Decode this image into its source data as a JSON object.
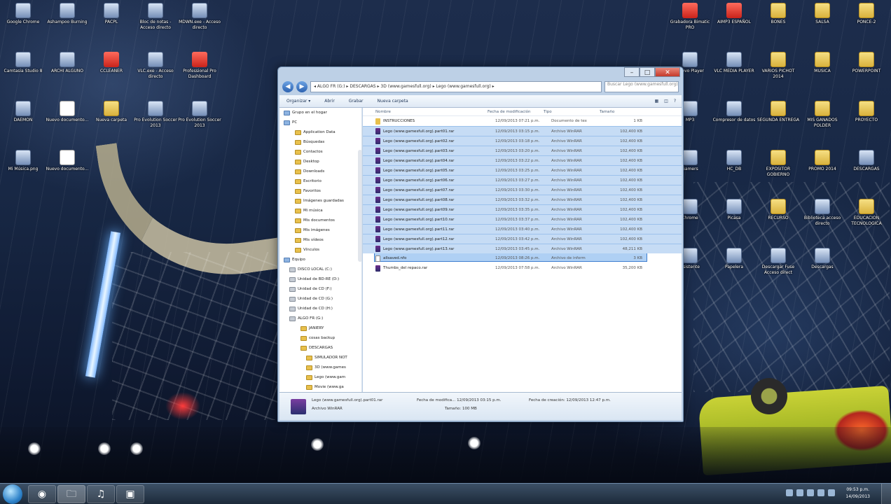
{
  "explorer": {
    "address": "◂ ALGO FR (G:) ▸ DESCARGAS ▸ 3D (www.gamesfull.org) ▸ Lego (www.gamesfull.org) ▸",
    "search_placeholder": "Buscar Lego (www.gamesfull.org)",
    "toolbar": {
      "organize": "Organizar ▾",
      "open": "Abrir",
      "share": "Grabar",
      "new_folder": "Nueva carpeta"
    },
    "columns": {
      "name": "Nombre",
      "date": "Fecha de modificación",
      "type": "Tipo",
      "size": "Tamaño"
    },
    "nav": [
      {
        "label": "Grupo en el hogar",
        "kind": "pc"
      },
      {
        "label": "PC",
        "kind": "pc"
      },
      {
        "label": "Application Data",
        "kind": "folder"
      },
      {
        "label": "Búsquedas",
        "kind": "folder"
      },
      {
        "label": "Contactos",
        "kind": "folder"
      },
      {
        "label": "Desktop",
        "kind": "folder"
      },
      {
        "label": "Downloads",
        "kind": "folder"
      },
      {
        "label": "Escritorio",
        "kind": "folder"
      },
      {
        "label": "Favoritos",
        "kind": "folder"
      },
      {
        "label": "Imágenes guardadas",
        "kind": "folder"
      },
      {
        "label": "Mi música",
        "kind": "folder"
      },
      {
        "label": "Mis documentos",
        "kind": "folder"
      },
      {
        "label": "Mis imágenes",
        "kind": "folder"
      },
      {
        "label": "Mis vídeos",
        "kind": "folder"
      },
      {
        "label": "Vínculos",
        "kind": "folder"
      },
      {
        "label": "Equipo",
        "kind": "pc"
      },
      {
        "label": "DISCO LOCAL (C:)",
        "kind": "drive"
      },
      {
        "label": "Unidad de BD-RE (D:)",
        "kind": "drive"
      },
      {
        "label": "Unidad de CD (F:)",
        "kind": "drive"
      },
      {
        "label": "Unidad de CD (G:)",
        "kind": "drive"
      },
      {
        "label": "Unidad de CD (H:)",
        "kind": "drive"
      },
      {
        "label": "ALGO FR (G:)",
        "kind": "drive"
      },
      {
        "label": "JANIERY",
        "kind": "folder"
      },
      {
        "label": "cosas backup",
        "kind": "folder"
      },
      {
        "label": "DESCARGAS",
        "kind": "folder"
      },
      {
        "label": "SIMULADOR NOT",
        "kind": "folder"
      },
      {
        "label": "3D (www.games",
        "kind": "folder"
      },
      {
        "label": "Lego (www.gam",
        "kind": "folder"
      },
      {
        "label": "Movie (www.ga",
        "kind": "folder"
      }
    ],
    "files": [
      {
        "name": "INSTRUCCIONES",
        "date": "12/09/2013 07:21 p.m.",
        "type": "Documento de tex",
        "size": "1 KB",
        "icon": "folder",
        "sel": false
      },
      {
        "name": "Lego (www.gamesfull.org).part01.rar",
        "date": "12/09/2013 03:15 p.m.",
        "type": "Archivo WinRAR",
        "size": "102,400 KB",
        "icon": "rar",
        "sel": true
      },
      {
        "name": "Lego (www.gamesfull.org).part02.rar",
        "date": "12/09/2013 03:18 p.m.",
        "type": "Archivo WinRAR",
        "size": "102,400 KB",
        "icon": "rar",
        "sel": true
      },
      {
        "name": "Lego (www.gamesfull.org).part03.rar",
        "date": "12/09/2013 03:20 p.m.",
        "type": "Archivo WinRAR",
        "size": "102,400 KB",
        "icon": "rar",
        "sel": true
      },
      {
        "name": "Lego (www.gamesfull.org).part04.rar",
        "date": "12/09/2013 03:22 p.m.",
        "type": "Archivo WinRAR",
        "size": "102,400 KB",
        "icon": "rar",
        "sel": true
      },
      {
        "name": "Lego (www.gamesfull.org).part05.rar",
        "date": "12/09/2013 03:25 p.m.",
        "type": "Archivo WinRAR",
        "size": "102,400 KB",
        "icon": "rar",
        "sel": true
      },
      {
        "name": "Lego (www.gamesfull.org).part06.rar",
        "date": "12/09/2013 03:27 p.m.",
        "type": "Archivo WinRAR",
        "size": "102,400 KB",
        "icon": "rar",
        "sel": true
      },
      {
        "name": "Lego (www.gamesfull.org).part07.rar",
        "date": "12/09/2013 03:30 p.m.",
        "type": "Archivo WinRAR",
        "size": "102,400 KB",
        "icon": "rar",
        "sel": true
      },
      {
        "name": "Lego (www.gamesfull.org).part08.rar",
        "date": "12/09/2013 03:32 p.m.",
        "type": "Archivo WinRAR",
        "size": "102,400 KB",
        "icon": "rar",
        "sel": true
      },
      {
        "name": "Lego (www.gamesfull.org).part09.rar",
        "date": "12/09/2013 03:35 p.m.",
        "type": "Archivo WinRAR",
        "size": "102,400 KB",
        "icon": "rar",
        "sel": true
      },
      {
        "name": "Lego (www.gamesfull.org).part10.rar",
        "date": "12/09/2013 03:37 p.m.",
        "type": "Archivo WinRAR",
        "size": "102,400 KB",
        "icon": "rar",
        "sel": true
      },
      {
        "name": "Lego (www.gamesfull.org).part11.rar",
        "date": "12/09/2013 03:40 p.m.",
        "type": "Archivo WinRAR",
        "size": "102,400 KB",
        "icon": "rar",
        "sel": true
      },
      {
        "name": "Lego (www.gamesfull.org).part12.rar",
        "date": "12/09/2013 03:42 p.m.",
        "type": "Archivo WinRAR",
        "size": "102,400 KB",
        "icon": "rar",
        "sel": true
      },
      {
        "name": "Lego (www.gamesfull.org).part13.rar",
        "date": "12/09/2013 03:45 p.m.",
        "type": "Archivo WinRAR",
        "size": "48,211 KB",
        "icon": "rar",
        "sel": true
      },
      {
        "name": "allsaved.nfo",
        "date": "12/09/2013 08:26 p.m.",
        "type": "Archivo de inform",
        "size": "3 KB",
        "icon": "txt",
        "sel": false
      },
      {
        "name": "Thumbs_del repaco.rar",
        "date": "12/09/2013 07:58 p.m.",
        "type": "Archivo WinRAR",
        "size": "35,200 KB",
        "icon": "rar",
        "sel": false
      }
    ],
    "details": {
      "name": "Lego (www.gamesfull.org).part01.rar",
      "kind": "Archivo WinRAR",
      "modified": "Fecha de modifica... 12/09/2013 03:15 p.m.",
      "created": "Fecha de creación: 12/09/2013 12:47 p.m.",
      "size": "Tamaño: 100 MB"
    }
  },
  "desktop_icons_left": [
    {
      "label": "Google Chrome",
      "style": "app"
    },
    {
      "label": "Ashampoo Burning",
      "style": "app"
    },
    {
      "label": "PACPL",
      "style": "app"
    },
    {
      "label": "Bloc de notas - Acceso directo",
      "style": "app"
    },
    {
      "label": "MDWN.exe - Acceso directo",
      "style": "app"
    },
    {
      "label": "Camtasia Studio 8",
      "style": "app"
    },
    {
      "label": "ARCHI ALGUNO",
      "style": "app"
    },
    {
      "label": "CCLEANER",
      "style": "red"
    },
    {
      "label": "VLC.exe - Acceso directo",
      "style": "app"
    },
    {
      "label": "Professional Pro Dashboard",
      "style": "red"
    },
    {
      "label": "DAEMON",
      "style": "app"
    },
    {
      "label": "Nuevo documento...",
      "style": "doc"
    },
    {
      "label": "Nueva carpeta",
      "style": "folder"
    },
    {
      "label": "Pro Evolution Soccer 2013",
      "style": "app"
    },
    {
      "label": "Pro Evolution Soccer 2013",
      "style": "app"
    },
    {
      "label": "Mi Música.png",
      "style": "app"
    },
    {
      "label": "Nuevo documento...",
      "style": "doc"
    }
  ],
  "desktop_icons_right": [
    {
      "label": "Grabadora Bimatic PRO",
      "style": "red"
    },
    {
      "label": "AIMP3 ESPAÑOL",
      "style": "red"
    },
    {
      "label": "BONES",
      "style": "folder"
    },
    {
      "label": "SALSA",
      "style": "folder"
    },
    {
      "label": "PONCE-2",
      "style": "folder"
    },
    {
      "label": "Nuevo Player",
      "style": "app"
    },
    {
      "label": "VLC MEDIA PLAYER",
      "style": "app"
    },
    {
      "label": "VARIOS PICHOT 2014",
      "style": "folder"
    },
    {
      "label": "MUSICA",
      "style": "folder"
    },
    {
      "label": "POWERPOINT",
      "style": "folder"
    },
    {
      "label": "MP3",
      "style": "app"
    },
    {
      "label": "Compresor de datos",
      "style": "app"
    },
    {
      "label": "SEGUNDA ENTREGA",
      "style": "folder"
    },
    {
      "label": "MIS GANADOS POLDER",
      "style": "folder"
    },
    {
      "label": "PROYECTO",
      "style": "folder"
    },
    {
      "label": "Gamers",
      "style": "app"
    },
    {
      "label": "HC_DB",
      "style": "app"
    },
    {
      "label": "EXPOSITOR GOBIERNO",
      "style": "folder"
    },
    {
      "label": "PROMO 2014",
      "style": "folder"
    },
    {
      "label": "DESCARGAS",
      "style": "app"
    },
    {
      "label": "Chrome",
      "style": "app"
    },
    {
      "label": "Picasa",
      "style": "app"
    },
    {
      "label": "RECURSO",
      "style": "folder"
    },
    {
      "label": "Biblioteca acceso directo",
      "style": "app"
    },
    {
      "label": "EDUCACION TECNOLOGICA",
      "style": "folder"
    },
    {
      "label": "Asistente",
      "style": "app"
    },
    {
      "label": "Papelera",
      "style": "app"
    },
    {
      "label": "Descargar Fuse Acceso direct",
      "style": "app"
    },
    {
      "label": "Descargas",
      "style": "app"
    }
  ],
  "taskbar": {
    "apps": [
      "◉",
      "🗀",
      "♫",
      "▣"
    ],
    "time": "09:53 p.m.",
    "date": "14/09/2013"
  }
}
